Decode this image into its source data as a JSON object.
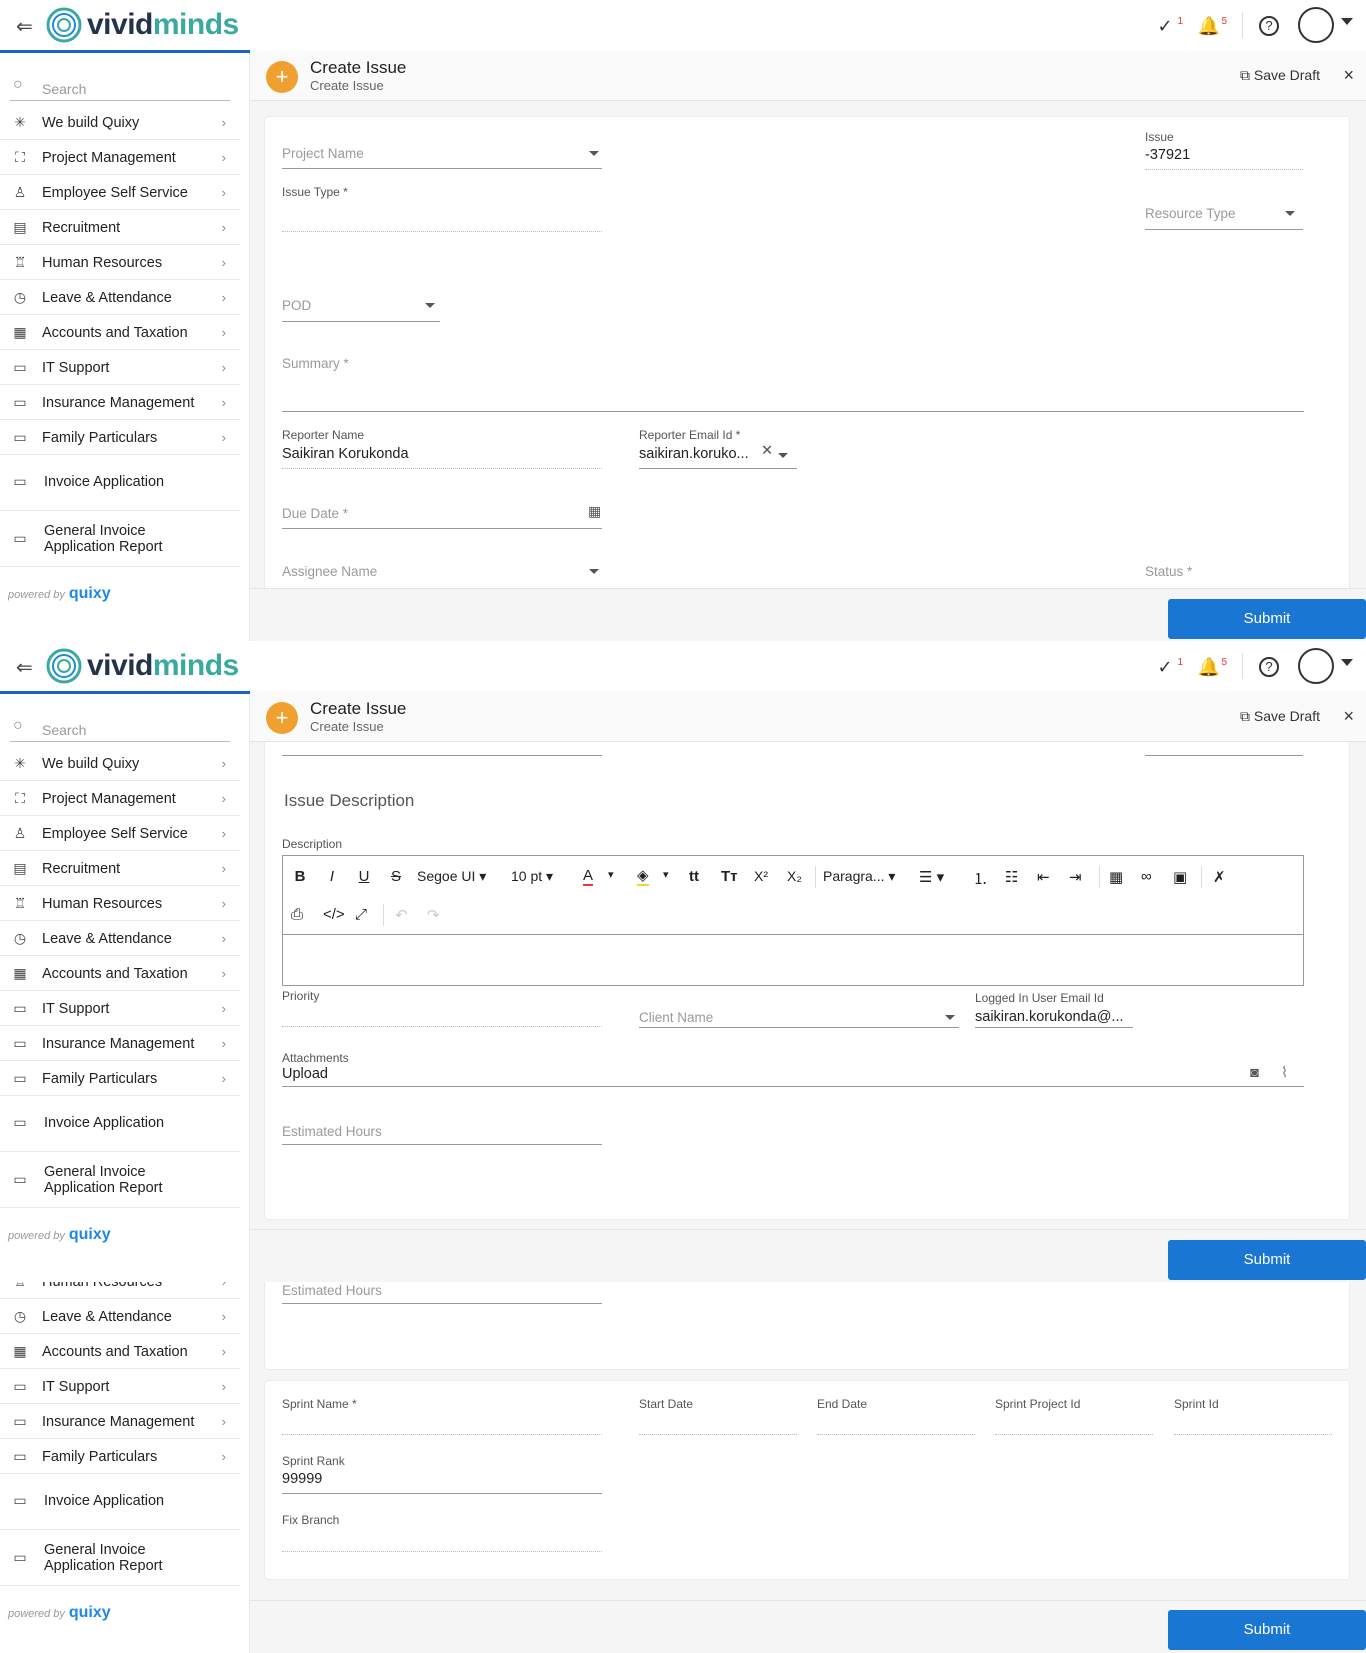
{
  "app": {
    "brand_a": "vivid",
    "brand_b": "minds",
    "accent": "#3aa99f",
    "primary": "#1976d2"
  },
  "topbar": {
    "tasks_badge": "1",
    "notifications_badge": "5",
    "icons": [
      "check-circle-icon",
      "bell-icon",
      "help-icon",
      "user-avatar-icon"
    ]
  },
  "sidebar": {
    "search_placeholder": "Search",
    "items": [
      {
        "label": "We build Quixy",
        "icon": "network-icon"
      },
      {
        "label": "Project Management",
        "icon": "flow-icon"
      },
      {
        "label": "Employee Self Service",
        "icon": "person-icon"
      },
      {
        "label": "Recruitment",
        "icon": "id-card-icon"
      },
      {
        "label": "Human Resources",
        "icon": "shirt-icon"
      },
      {
        "label": "Leave & Attendance",
        "icon": "clock-icon"
      },
      {
        "label": "Accounts and Taxation",
        "icon": "ledger-icon"
      },
      {
        "label": "IT Support",
        "icon": "monitor-icon"
      },
      {
        "label": "Insurance Management",
        "icon": "folder-icon"
      },
      {
        "label": "Family Particulars",
        "icon": "folder-icon"
      },
      {
        "label": "Invoice Application",
        "icon": "folder-icon"
      },
      {
        "label": "General Invoice Application Report",
        "icon": "folder-icon"
      }
    ],
    "powered_by": "powered by",
    "powered_brand": "quixy"
  },
  "header": {
    "title": "Create Issue",
    "subtitle": "Create Issue",
    "save_draft": "Save Draft",
    "close": "×"
  },
  "form": {
    "project_name": "Project Name",
    "issue_label": "Issue",
    "issue_value": "-37921",
    "issue_type": "Issue Type *",
    "resource_type": "Resource Type",
    "pod": "POD",
    "summary": "Summary *",
    "reporter_name_label": "Reporter Name",
    "reporter_name_value": "Saikiran Korukonda",
    "reporter_email_label": "Reporter Email Id *",
    "reporter_email_value": "saikiran.koruko...",
    "due_date": "Due Date *",
    "assignee_name": "Assignee Name",
    "status": "Status *",
    "issue_description_title": "Issue Description",
    "description_label": "Description",
    "priority_label": "Priority",
    "client_name": "Client Name",
    "logged_email_label": "Logged In User Email Id",
    "logged_email_value": "saikiran.korukonda@...",
    "attachments_label": "Attachments",
    "upload": "Upload",
    "estimated_hours": "Estimated Hours",
    "sprint_name": "Sprint Name *",
    "start_date": "Start Date",
    "end_date": "End Date",
    "sprint_project_id": "Sprint Project Id",
    "sprint_id": "Sprint Id",
    "sprint_rank_label": "Sprint Rank",
    "sprint_rank_value": "99999",
    "fix_branch": "Fix Branch",
    "submit": "Submit"
  },
  "editor": {
    "font": "Segoe UI",
    "size": "10 pt",
    "block": "Paragra...",
    "bold": "B",
    "italic": "I",
    "underline": "U",
    "strike": "S",
    "superscript": "X²",
    "subscript": "X₂"
  }
}
